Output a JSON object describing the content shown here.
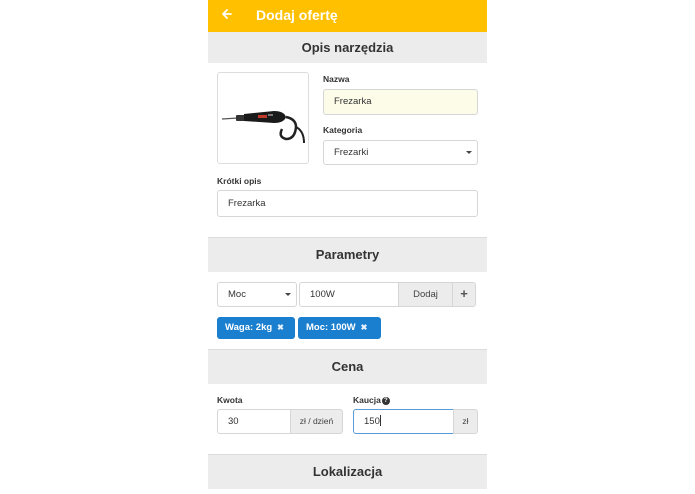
{
  "header": {
    "title": "Dodaj ofertę"
  },
  "tool_section": {
    "title": "Opis narzędzia",
    "name_label": "Nazwa",
    "name_value": "Frezarka",
    "category_label": "Kategoria",
    "category_value": "Frezarki",
    "short_desc_label": "Krótki opis",
    "short_desc_value": "Frezarka"
  },
  "params_section": {
    "title": "Parametry",
    "param_select": "Moc",
    "param_value": "100W",
    "add_label": "Dodaj",
    "plus_label": "+",
    "tags": [
      {
        "label": "Waga: 2kg"
      },
      {
        "label": "Moc: 100W"
      }
    ]
  },
  "price_section": {
    "title": "Cena",
    "amount_label": "Kwota",
    "amount_value": "30",
    "amount_unit": "zł / dzień",
    "deposit_label": "Kaucja",
    "deposit_value": "150",
    "deposit_unit": "zł"
  },
  "location_section": {
    "title": "Lokalizacja"
  },
  "colors": {
    "accent": "#ffc000",
    "tag": "#1b7fd0"
  },
  "icons": {
    "back": "arrow-left-icon",
    "help": "question-circle-icon",
    "remove": "close-icon"
  }
}
